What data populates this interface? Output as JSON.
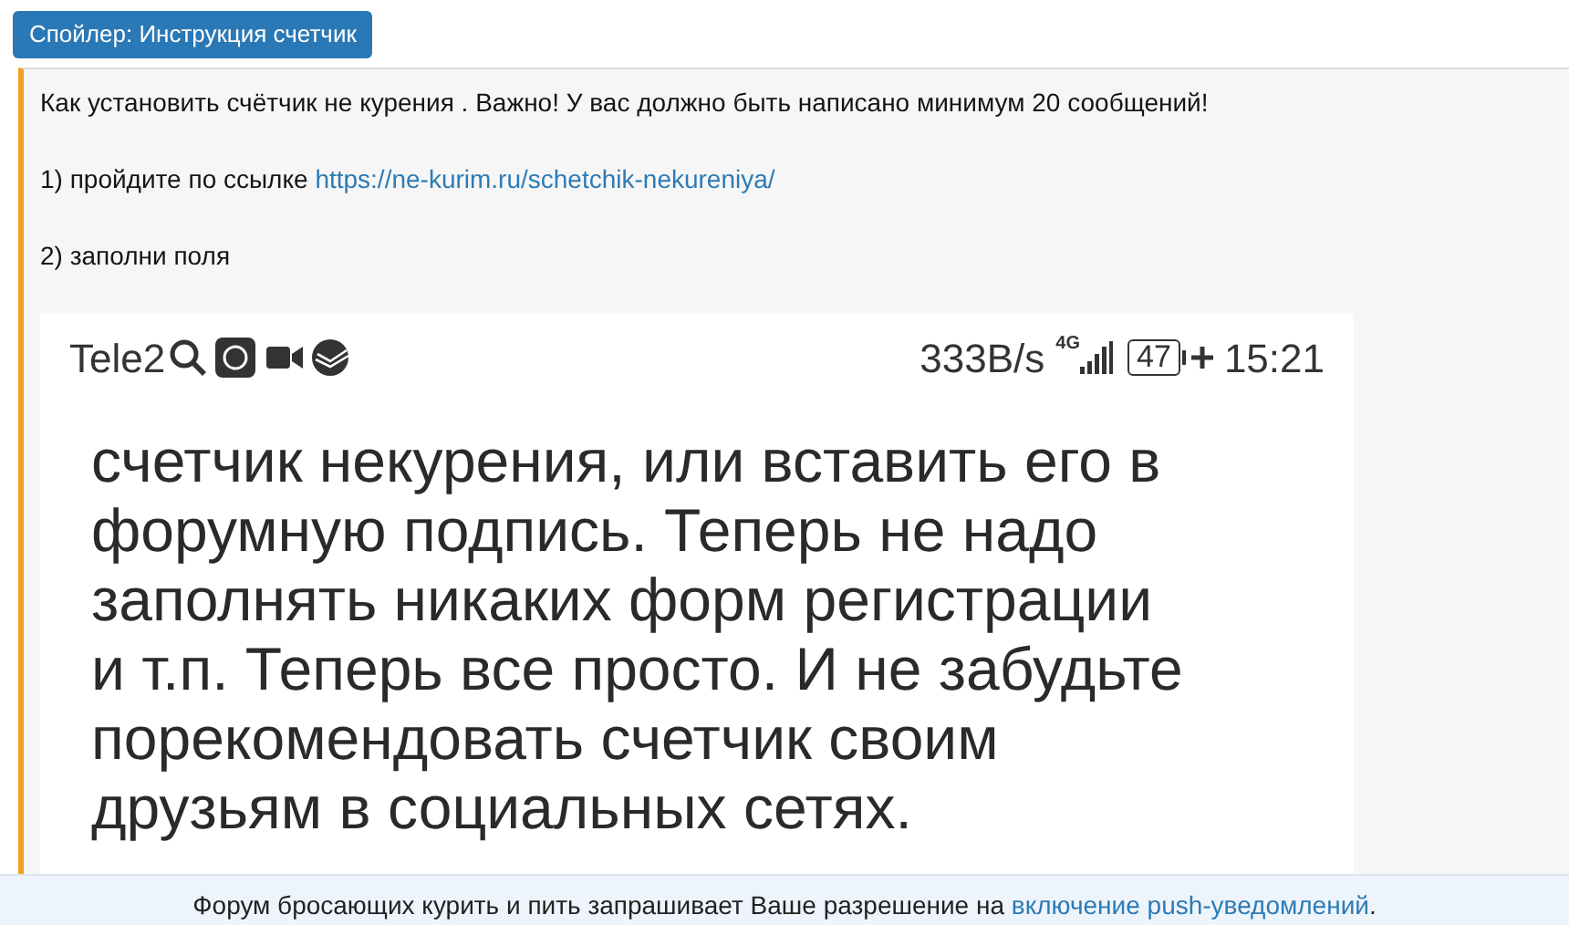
{
  "spoiler_button": {
    "label": "Спойлер: Инструкция счетчик"
  },
  "spoiler_content": {
    "paragraphs": [
      {
        "text": "Как установить счётчик не курения . Важно! У вас должно быть написано минимум 20 сообщений!"
      },
      {
        "text": "1) пройдите по ссылке ",
        "link": "https://ne-kurim.ru/schetchik-nekureniya/"
      },
      {
        "text": "2) заполни поля"
      }
    ],
    "phone_screenshot": {
      "status_bar": {
        "carrier": "Tele2",
        "speed": "333B/s",
        "network": "4G",
        "battery": "47",
        "time": "15:21"
      },
      "lines": [
        "счетчик некурения, или вставить его в",
        "форумную подпись. Теперь не надо",
        "заполнять никаких форм регистрации",
        "и т.п. Теперь все просто. И не забудьте",
        "порекомендовать счетчик своим",
        "друзьям в социальных сетях."
      ]
    }
  },
  "notice_bar": {
    "text": "Форум бросающих курить и пить запрашивает Ваше разрешение на ",
    "link": "включение push-уведомлений",
    "suffix": "."
  }
}
